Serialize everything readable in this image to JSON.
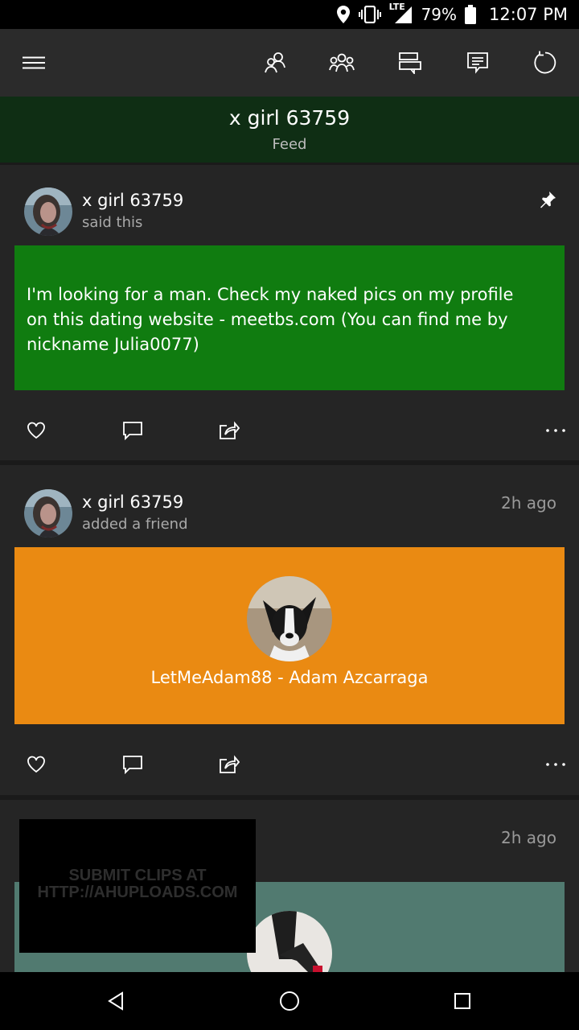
{
  "status_bar": {
    "network": "LTE",
    "battery": "79%",
    "time": "12:07 PM",
    "icons": [
      "location-icon",
      "vibrate-icon",
      "signal-icon",
      "battery-icon"
    ]
  },
  "app_bar": {
    "icons": [
      "menu-icon",
      "friends-icon",
      "party-icon",
      "conversations-icon",
      "messages-icon",
      "refresh-icon"
    ]
  },
  "header": {
    "title": "x girl 63759",
    "subtitle": "Feed"
  },
  "posts": [
    {
      "author": "x girl 63759",
      "action": "said this",
      "pinned": true,
      "text": "I'm looking for a man. Check my naked pics on my profile on this dating website - meetbs.com (You can find me by nickname Julia0077)",
      "content_color": "#107c10"
    },
    {
      "author": "x girl 63759",
      "action": "added a friend",
      "time": "2h ago",
      "friend": "LetMeAdam88 - Adam Azcarraga",
      "content_color": "#ea8a12"
    },
    {
      "time": "2h ago",
      "content_color": "#517a70"
    }
  ],
  "watermark": {
    "line1": "SUBMIT CLIPS AT",
    "line2": "HTTP://AHUPLOADS.COM"
  },
  "nav_bar": {
    "icons": [
      "back-icon",
      "home-icon",
      "recents-icon"
    ]
  }
}
